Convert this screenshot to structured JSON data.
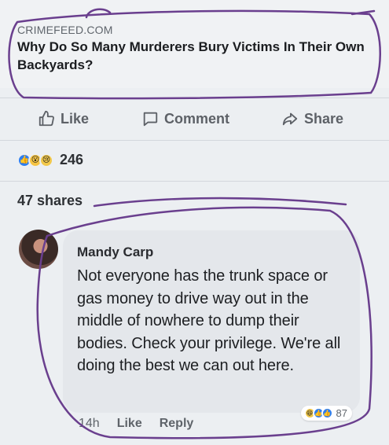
{
  "link_preview": {
    "domain": "CRIMEFEED.COM",
    "title": "Why Do So Many Murderers Bury Victims In Their Own Backyards?"
  },
  "actions": {
    "like": "Like",
    "comment": "Comment",
    "share": "Share"
  },
  "reactions": {
    "icons": [
      "like-icon",
      "wow-icon",
      "sad-icon"
    ],
    "count": "246"
  },
  "shares": "47 shares",
  "comment": {
    "author": "Mandy Carp",
    "text": "Not everyone has the trunk space or gas money to drive way out in the middle of nowhere to dump their bodies. Check your privilege. We're all doing the best we can out here.",
    "time": "14h",
    "like": "Like",
    "reply": "Reply",
    "reaction_count": "87"
  },
  "colors": {
    "accent_blue": "#2e7ff0",
    "annotation_purple": "#6a3f8e"
  }
}
